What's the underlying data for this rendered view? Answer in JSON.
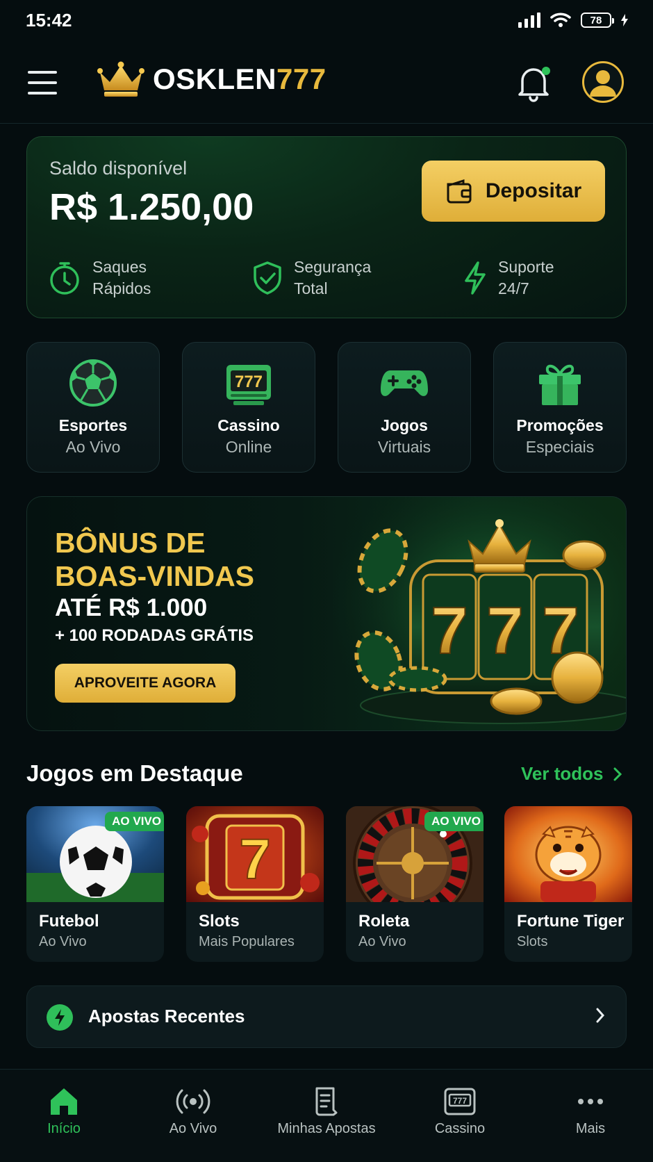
{
  "status_bar": {
    "time": "15:42",
    "battery": "78"
  },
  "header": {
    "brand_main": "OSKLEN",
    "brand_accent": "777"
  },
  "balance": {
    "label": "Saldo disponível",
    "value": "R$ 1.250,00",
    "deposit_label": "Depositar",
    "features": [
      {
        "icon": "stopwatch-icon",
        "line1": "Saques",
        "line2": "Rápidos"
      },
      {
        "icon": "shield-check-icon",
        "line1": "Segurança",
        "line2": "Total"
      },
      {
        "icon": "lightning-icon",
        "line1": "Suporte",
        "line2": "24/7"
      }
    ]
  },
  "categories": [
    {
      "icon": "soccer-ball-icon",
      "title": "Esportes",
      "sub": "Ao Vivo"
    },
    {
      "icon": "slot-machine-icon",
      "title": "Cassino",
      "sub": "Online"
    },
    {
      "icon": "gamepad-icon",
      "title": "Jogos",
      "sub": "Virtuais"
    },
    {
      "icon": "gift-icon",
      "title": "Promoções",
      "sub": "Especiais"
    }
  ],
  "banner": {
    "title_line1": "BÔNUS DE",
    "title_line2": "BOAS-VINDAS",
    "amount": "ATÉ R$ 1.000",
    "spins": "+ 100 RODADAS GRÁTIS",
    "cta": "APROVEITE AGORA",
    "reels": "777"
  },
  "featured": {
    "title": "Jogos em Destaque",
    "see_all": "Ver todos",
    "games": [
      {
        "name": "Futebol",
        "sub": "Ao Vivo",
        "badge": "AO VIVO"
      },
      {
        "name": "Slots",
        "sub": "Mais Populares",
        "badge": ""
      },
      {
        "name": "Roleta",
        "sub": "Ao Vivo",
        "badge": "AO VIVO"
      },
      {
        "name": "Fortune Tiger",
        "sub": "Slots",
        "badge": ""
      }
    ]
  },
  "recent": {
    "label": "Apostas Recentes"
  },
  "nav": [
    {
      "label": "Início",
      "icon": "home-icon",
      "active": true
    },
    {
      "label": "Ao Vivo",
      "icon": "broadcast-icon",
      "active": false
    },
    {
      "label": "Minhas Apostas",
      "icon": "ticket-icon",
      "active": false
    },
    {
      "label": "Cassino",
      "icon": "slot-machine-icon",
      "active": false
    },
    {
      "label": "Mais",
      "icon": "more-dots-icon",
      "active": false
    }
  ],
  "colors": {
    "accent_green": "#2fc25a",
    "gold": "#e8b93d",
    "background": "#050d0f"
  }
}
